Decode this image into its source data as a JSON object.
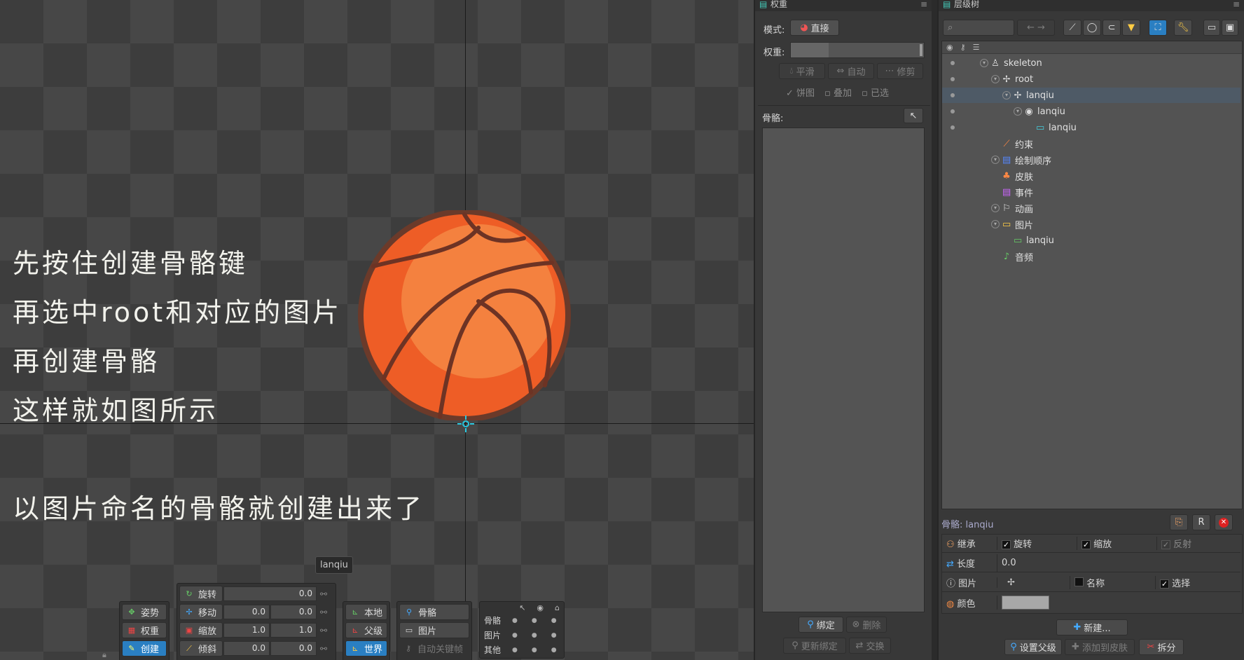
{
  "viewport": {
    "notes": [
      "先按住创建骨骼键",
      "再选中root和对应的图片",
      "再创建骨骼",
      "这样就如图所示",
      "以图片命名的骨骼就创建出来了"
    ],
    "tooltip": "lanqiu"
  },
  "toolbar": {
    "modes": [
      {
        "label": "姿势",
        "icon": "pose-icon"
      },
      {
        "label": "权重",
        "icon": "weights-icon"
      },
      {
        "label": "创建",
        "icon": "create-icon",
        "active": true
      }
    ],
    "transforms": [
      {
        "label": "旋转",
        "icon": "rotate-icon",
        "values": [
          "0.0"
        ]
      },
      {
        "label": "移动",
        "icon": "translate-icon",
        "values": [
          "0.0",
          "0.0"
        ]
      },
      {
        "label": "缩放",
        "icon": "scale-icon",
        "values": [
          "1.0",
          "1.0"
        ]
      },
      {
        "label": "倾斜",
        "icon": "shear-icon",
        "values": [
          "0.0",
          "0.0"
        ]
      }
    ],
    "axes": [
      {
        "label": "本地"
      },
      {
        "label": "父级"
      },
      {
        "label": "世界",
        "active": true
      }
    ],
    "compensate": [
      {
        "label": "骨骼"
      },
      {
        "label": "图片"
      },
      {
        "label": "自动关键帧"
      }
    ],
    "visibility": {
      "rows": [
        "骨骼",
        "图片",
        "其他"
      ]
    }
  },
  "weights": {
    "title": "权重",
    "mode_label": "模式:",
    "mode_value": "直接",
    "weight_label": "权重:",
    "buttons": [
      "平滑",
      "自动",
      "修剪"
    ],
    "checks": [
      "饼图",
      "叠加",
      "已选"
    ],
    "bones_label": "骨骼:",
    "bind": "绑定",
    "remove": "删除",
    "update_binding": "更新绑定",
    "swap": "交换"
  },
  "tree": {
    "title": "层级树",
    "items": [
      {
        "label": "skeleton",
        "indent": 0,
        "icon": "skeleton-icon"
      },
      {
        "label": "root",
        "indent": 1,
        "icon": "bone-icon"
      },
      {
        "label": "lanqiu",
        "indent": 2,
        "icon": "bone-icon",
        "selected": true
      },
      {
        "label": "lanqiu",
        "indent": 3,
        "icon": "slot-icon"
      },
      {
        "label": "lanqiu",
        "indent": 4,
        "icon": "attachment-icon"
      },
      {
        "label": "约束",
        "indent": 1,
        "icon": "constraint-icon"
      },
      {
        "label": "绘制顺序",
        "indent": 1,
        "icon": "draw-order-icon"
      },
      {
        "label": "皮肤",
        "indent": 1,
        "icon": "skin-icon"
      },
      {
        "label": "事件",
        "indent": 1,
        "icon": "event-icon"
      },
      {
        "label": "动画",
        "indent": 1,
        "icon": "animation-icon"
      },
      {
        "label": "图片",
        "indent": 1,
        "icon": "images-icon"
      },
      {
        "label": "lanqiu",
        "indent": 2,
        "icon": "image-icon"
      },
      {
        "label": "音频",
        "indent": 1,
        "icon": "audio-icon"
      }
    ]
  },
  "bone_props": {
    "title": "骨骼: lanqiu",
    "inherit": "继承",
    "rotation": "旋转",
    "scale": "缩放",
    "reflect": "反射",
    "length_label": "长度",
    "length_value": "0.0",
    "image_label": "图片",
    "name": "名称",
    "select": "选择",
    "color_label": "颜色",
    "color_value": "#a8a8a8",
    "new_btn": "新建...",
    "set_parent": "设置父级",
    "add_to_skin": "添加到皮肤",
    "split": "拆分"
  }
}
